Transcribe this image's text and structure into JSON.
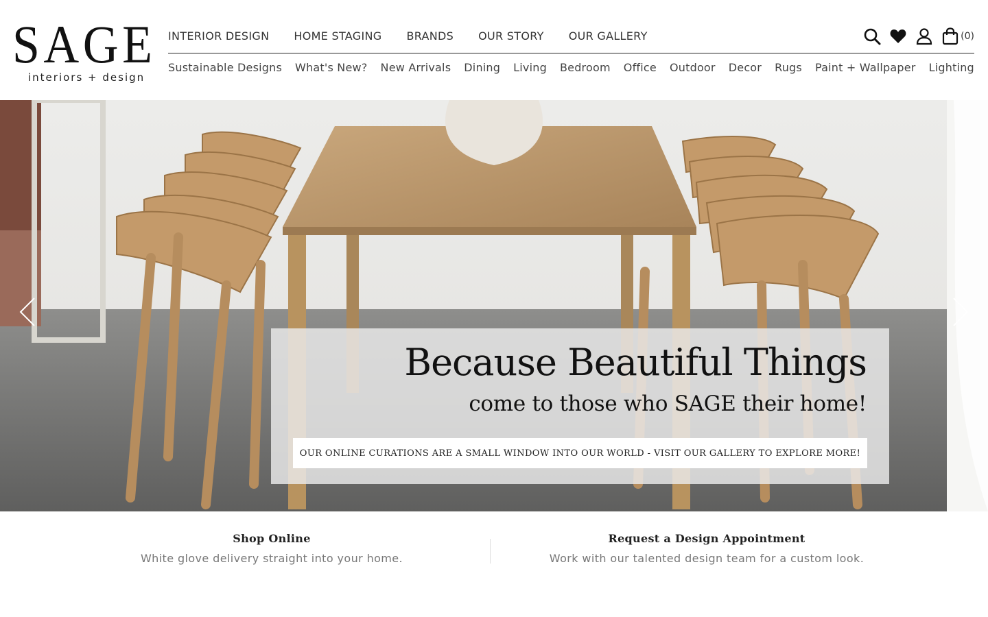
{
  "brand": {
    "name": "SAGE",
    "tagline": "interiors + design"
  },
  "top_nav": [
    "INTERIOR DESIGN",
    "HOME STAGING",
    "BRANDS",
    "OUR STORY",
    "OUR GALLERY"
  ],
  "sub_nav": [
    "Sustainable Designs",
    "What's New?",
    "New Arrivals",
    "Dining",
    "Living",
    "Bedroom",
    "Office",
    "Outdoor",
    "Decor",
    "Rugs",
    "Paint + Wallpaper",
    "Lighting"
  ],
  "header_icons": {
    "search": "search-icon",
    "wishlist": "heart-icon",
    "account": "user-icon",
    "cart": "bag-icon"
  },
  "cart": {
    "count_label": "(0)"
  },
  "hero": {
    "headline": "Because Beautiful Things",
    "subheadline": "come to those who SAGE their home!",
    "cta": "OUR ONLINE CURATIONS ARE A SMALL WINDOW INTO OUR WORLD - VISIT OUR GALLERY TO EXPLORE MORE!"
  },
  "features": [
    {
      "title": "Shop Online",
      "description": "White glove delivery straight into your home."
    },
    {
      "title": "Request a Design Appointment",
      "description": "Work with our talented design team for a custom look."
    }
  ]
}
